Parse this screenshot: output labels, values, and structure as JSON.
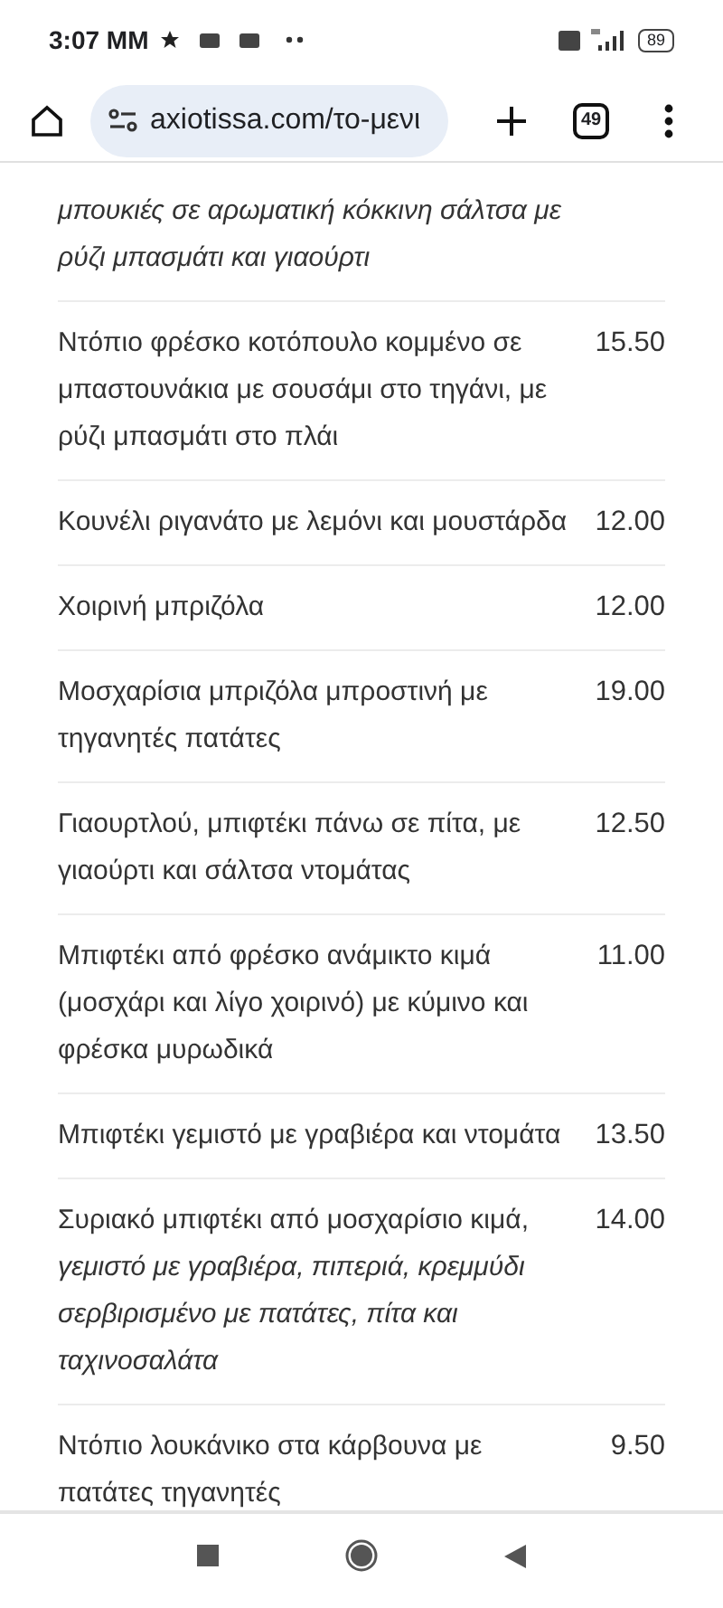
{
  "status_bar": {
    "time": "3:07 MM",
    "battery": "89"
  },
  "browser": {
    "url": "axiotissa.com/το-μενι",
    "tab_count": "49"
  },
  "menu": [
    {
      "name": "μπουκιές σε αρωματική κόκκινη σάλτσα με ρύζι μπασμάτι και γιαούρτι",
      "italic": true
    },
    {
      "name": "Ντόπιο φρέσκο κοτόπουλο κομμένο σε μπαστουνάκια με σουσάμι στο τηγάνι, με ρύζι μπασμάτι στο πλάι",
      "price": "15.50",
      "italic": false
    },
    {
      "name": "Κουνέλι ριγανάτο με λεμόνι και μουστάρδα",
      "price": "12.00",
      "italic": false
    },
    {
      "name": "Χοιρινή μπριζόλα",
      "price": "12.00",
      "italic": false
    },
    {
      "name": "Μοσχαρίσια μπριζόλα μπροστινή με τηγανητές πατάτες",
      "price": "19.00",
      "italic": false
    },
    {
      "name": "Γιαουρτλού, μπιφτέκι πάνω σε πίτα, με γιαούρτι και σάλτσα ντομάτας",
      "price": "12.50",
      "italic": false
    },
    {
      "name": "Μπιφτέκι από φρέσκο ανάμικτο κιμά (μοσχάρι και λίγο χοιρινό) με κύμινο και φρέσκα μυρωδικά",
      "price": "11.00",
      "italic": false
    },
    {
      "name": "Μπιφτέκι γεμιστό με γραβιέρα και ντομάτα",
      "price": "13.50",
      "italic": false
    },
    {
      "name": "Συριακό μπιφτέκι από μοσχαρίσιο κιμά, *γεμιστό με γραβιέρα, πιπεριά, κρεμμύδι σερβιρισμένο με πατάτες, πίτα και ταχινοσαλάτα*",
      "price": "14.00",
      "italic": false
    },
    {
      "name": "Ντόπιο λουκάνικο στα κάρβουνα με πατάτες τηγανητές",
      "price": "9.50",
      "italic": false
    }
  ]
}
